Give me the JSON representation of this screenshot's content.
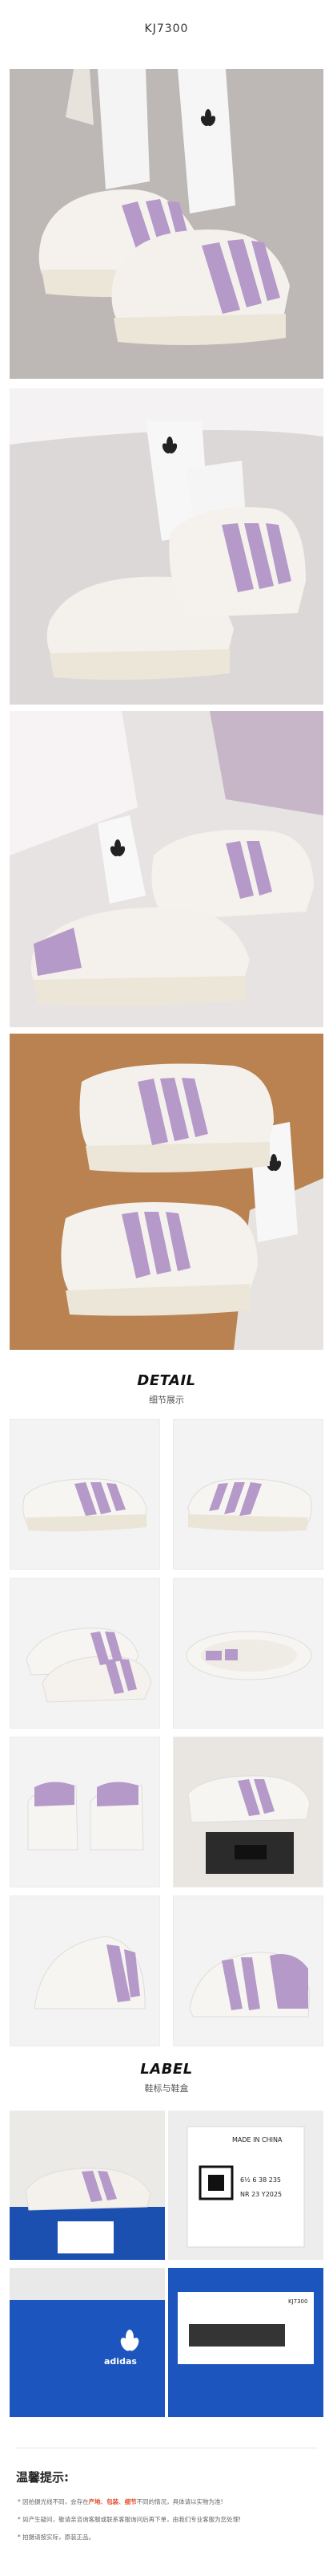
{
  "product_code": "KJ7300",
  "detail": {
    "title_en": "DETAIL",
    "title_cn": "细节展示"
  },
  "label": {
    "title_en": "LABEL",
    "title_cn": "鞋标与鞋盒"
  },
  "tag": {
    "made_in": "MADE IN CHINA",
    "line1": "6½  6  38  235",
    "line2": "NR  23  Y2025"
  },
  "box": {
    "brand": "adidas",
    "code": "KJ7300"
  },
  "tips": {
    "title": "温馨提示:",
    "line1_prefix": "* 因拍摄光线不同，会存在",
    "k1": "产地",
    "sep1": "、",
    "k2": "包装",
    "sep2": "、",
    "k3": "细节",
    "line1_suffix": "不同的情况，具体请以实物为准!",
    "line2": "* 如产生疑问，敬请亲咨询客服或联系客服询问后再下单，由我们专业客服为您处理!",
    "line3": "* 拍摄请按实际，原装正品。"
  },
  "colors": {
    "accent": "#b59ac9",
    "shoe_white": "#f4f1ec",
    "sole": "#ece6d8"
  }
}
